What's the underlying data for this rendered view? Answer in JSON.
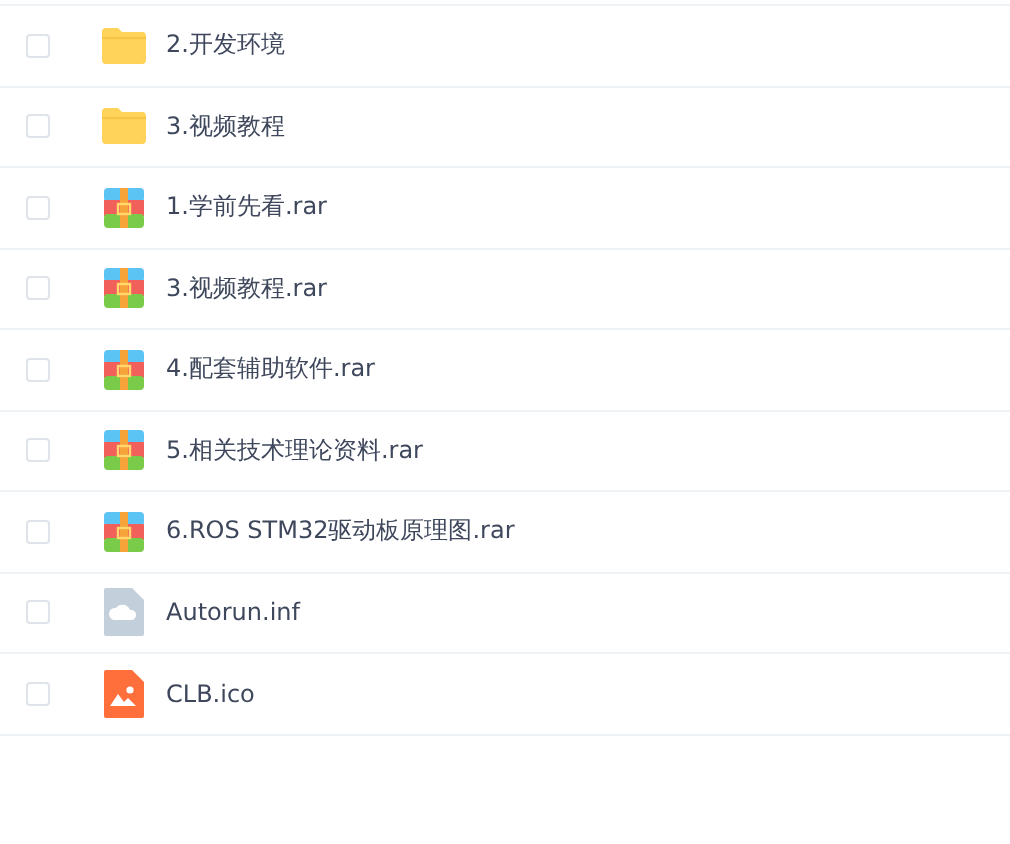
{
  "files": [
    {
      "name": "2.开发环境",
      "kind": "folder",
      "checked": false
    },
    {
      "name": "3.视频教程",
      "kind": "folder",
      "checked": false
    },
    {
      "name": "1.学前先看.rar",
      "kind": "archive",
      "checked": false
    },
    {
      "name": "3.视频教程.rar",
      "kind": "archive",
      "checked": false
    },
    {
      "name": "4.配套辅助软件.rar",
      "kind": "archive",
      "checked": false
    },
    {
      "name": "5.相关技术理论资料.rar",
      "kind": "archive",
      "checked": false
    },
    {
      "name": "6.ROS STM32驱动板原理图.rar",
      "kind": "archive",
      "checked": false
    },
    {
      "name": "Autorun.inf",
      "kind": "file",
      "checked": false
    },
    {
      "name": "CLB.ico",
      "kind": "image",
      "checked": false
    }
  ]
}
